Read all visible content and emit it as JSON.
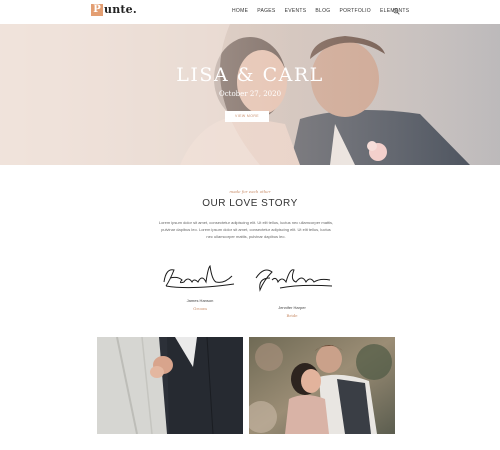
{
  "nav": {
    "logo_letter": "P",
    "logo_text": "unte.",
    "items": [
      "HOME",
      "PAGES",
      "EVENTS",
      "BLOG",
      "PORTFOLIO",
      "ELEMENTS"
    ],
    "search_icon": "search-icon"
  },
  "hero": {
    "title": "LISA & CARL",
    "date": "October 27, 2020",
    "button_label": "VIEW MORE"
  },
  "story": {
    "kicker": "made for each other",
    "title": "OUR LOVE STORY",
    "text": "Lorem ipsum dolor sit amet, consectetur adipiscing elit. Ut elit tellus, luctus nec ullamcorper mattis, pulvinar dapibus leo. Lorem ipsum dolor sit amet, consectetur adipiscing elit. Ut elit tellus, luctus nec ullamcorper mattis, pulvinar dapibus leo."
  },
  "couple": [
    {
      "name": "James Hanson",
      "role": "Groom"
    },
    {
      "name": "Jennifer Harper",
      "role": "Bride"
    }
  ],
  "colors": {
    "accent": "#c98e6a",
    "logo_box": "#e39e72"
  }
}
